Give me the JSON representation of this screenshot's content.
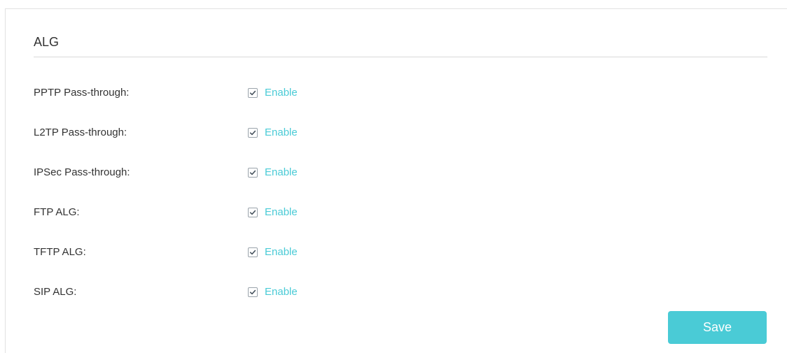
{
  "section": {
    "title": "ALG"
  },
  "rows": [
    {
      "label": "PPTP Pass-through:",
      "checkbox_label": "Enable",
      "checked": true
    },
    {
      "label": "L2TP Pass-through:",
      "checkbox_label": "Enable",
      "checked": true
    },
    {
      "label": "IPSec Pass-through:",
      "checkbox_label": "Enable",
      "checked": true
    },
    {
      "label": "FTP ALG:",
      "checkbox_label": "Enable",
      "checked": true
    },
    {
      "label": "TFTP ALG:",
      "checkbox_label": "Enable",
      "checked": true
    },
    {
      "label": "SIP ALG:",
      "checkbox_label": "Enable",
      "checked": true
    }
  ],
  "actions": {
    "save_label": "Save"
  },
  "colors": {
    "accent": "#4acbd6",
    "text": "#333333",
    "divider": "#d9d9d9",
    "checkbox_border": "#9aa3ab"
  },
  "icons": {
    "checkbox_checked": "checkmark-icon"
  }
}
